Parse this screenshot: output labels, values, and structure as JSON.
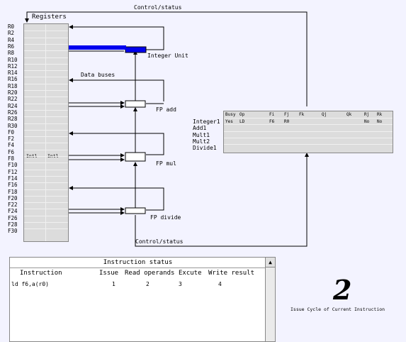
{
  "diagram": {
    "registers_title": "Registers",
    "control_status_top": "Control/status",
    "control_status_bottom": "Control/status",
    "data_buses": "Data buses",
    "units": {
      "integer": "Integer Unit",
      "fp_add": "FP add",
      "fp_mul": "FP mul",
      "fp_divide": "FP divide"
    },
    "registers": [
      "R0",
      "R2",
      "R4",
      "R6",
      "R8",
      "R10",
      "R12",
      "R14",
      "R16",
      "R18",
      "R20",
      "R22",
      "R24",
      "R26",
      "R28",
      "R30",
      "F0",
      "F2",
      "F4",
      "F6",
      "F8",
      "F10",
      "F12",
      "F14",
      "F16",
      "F18",
      "F20",
      "F22",
      "F24",
      "F26",
      "F28",
      "F30"
    ],
    "f6_cells": [
      "Intl",
      "Intl"
    ],
    "active_bus_color": "#0000ee"
  },
  "fu_status": {
    "headers": [
      "Busy",
      "Op",
      "Fi",
      "Fj",
      "Fk",
      "Qj",
      "Qk",
      "Rj",
      "Rk"
    ],
    "rows": [
      {
        "name": "Integer1",
        "busy": "Yes",
        "op": "LD",
        "fi": "F6",
        "fj": "R0",
        "fk": "",
        "qj": "",
        "qk": "",
        "rj": "No",
        "rk": "No"
      },
      {
        "name": "Add1",
        "busy": "",
        "op": "",
        "fi": "",
        "fj": "",
        "fk": "",
        "qj": "",
        "qk": "",
        "rj": "",
        "rk": ""
      },
      {
        "name": "Mult1",
        "busy": "",
        "op": "",
        "fi": "",
        "fj": "",
        "fk": "",
        "qj": "",
        "qk": "",
        "rj": "",
        "rk": ""
      },
      {
        "name": "Mult2",
        "busy": "",
        "op": "",
        "fi": "",
        "fj": "",
        "fk": "",
        "qj": "",
        "qk": "",
        "rj": "",
        "rk": ""
      },
      {
        "name": "Divide1",
        "busy": "",
        "op": "",
        "fi": "",
        "fj": "",
        "fk": "",
        "qj": "",
        "qk": "",
        "rj": "",
        "rk": ""
      }
    ]
  },
  "instruction_status": {
    "title": "Instruction status",
    "headers": {
      "instruction": "Instruction",
      "issue": "Issue",
      "read": "Read operands",
      "execute": "Excute",
      "write": "Write result"
    },
    "rows": [
      {
        "instruction": "ld f6,a(r0)",
        "issue": "1",
        "read": "2",
        "execute": "3",
        "write": "4"
      }
    ],
    "scroll_up_glyph": "▲"
  },
  "cycle": {
    "value": "2",
    "caption": "Issue Cycle of Current Instruction"
  }
}
